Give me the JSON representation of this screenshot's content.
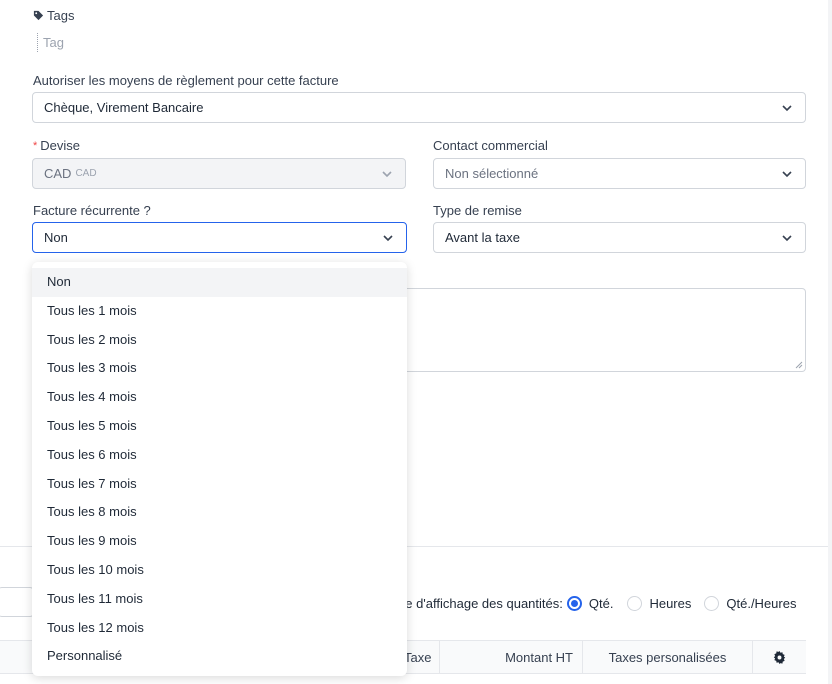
{
  "tags": {
    "label": "Tags",
    "placeholder": "Tag"
  },
  "payment": {
    "label": "Autoriser les moyens de règlement pour cette facture",
    "value": "Chèque, Virement Bancaire"
  },
  "currency": {
    "label": "Devise",
    "required_mark": "*",
    "value": "CAD",
    "sub": "CAD"
  },
  "contact": {
    "label": "Contact commercial",
    "value": "Non sélectionné"
  },
  "recurring": {
    "label": "Facture récurrente ?",
    "value": "Non"
  },
  "discount": {
    "label": "Type de remise",
    "value": "Avant la taxe"
  },
  "dropdown": {
    "options": [
      "Non",
      "Tous les 1 mois",
      "Tous les 2 mois",
      "Tous les 3 mois",
      "Tous les 4 mois",
      "Tous les 5 mois",
      "Tous les 6 mois",
      "Tous les 7 mois",
      "Tous les 8 mois",
      "Tous les 9 mois",
      "Tous les 10 mois",
      "Tous les 11 mois",
      "Tous les 12 mois",
      "Personnalisé"
    ],
    "selected_index": 0
  },
  "quantity": {
    "label": "pe d'affichage des quantités:",
    "options": [
      "Qté.",
      "Heures",
      "Qté./Heures"
    ],
    "selected_index": 0
  },
  "table": {
    "headers": [
      "Taxe",
      "Montant HT",
      "Taxes personalisées"
    ],
    "settings_icon": "gear-icon"
  },
  "colors": {
    "accent": "#2563eb",
    "required": "#ef4444"
  }
}
